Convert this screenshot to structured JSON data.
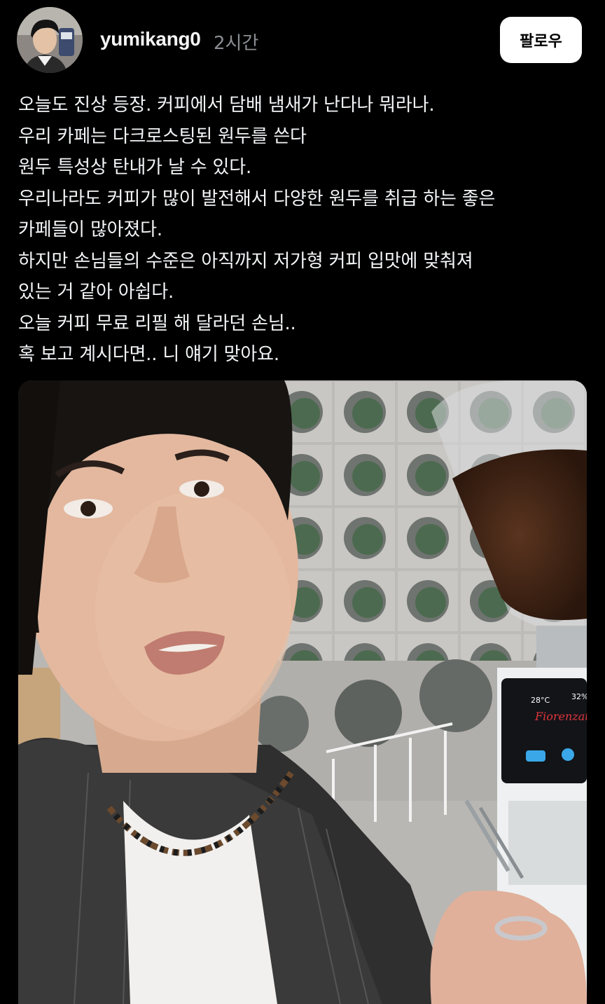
{
  "post": {
    "author": {
      "username": "yumikang0"
    },
    "timestamp": "2시간",
    "follow_label": "팔로우",
    "text_lines": [
      "오늘도 진상 등장. 커피에서 담배 냄새가 난다나 뭐라나.",
      "우리 카페는 다크로스팅된 원두를 쓴다",
      "원두 특성상 탄내가 날 수 있다.",
      "우리나라도 커피가 많이 발전해서 다양한 원두를 취급 하는 좋은",
      "카페들이 많아졌다.",
      "하지만 손님들의 수준은 아직까지 저가형 커피 입맛에 맞춰져",
      "있는 거 같아 아쉽다.",
      "오늘 커피 무료 리필 해 달라던 손님..",
      "혹 보고 계시다면.. 니 얘기 맞아요."
    ],
    "media": {
      "kind": "photo",
      "display_brand": "Fiorenzato",
      "display_temp": "28°C",
      "display_pct": "32%"
    }
  },
  "colors": {
    "background": "#000000",
    "text_primary": "#f3f5f7",
    "text_secondary": "#8a8d91",
    "follow_button_bg": "#ffffff",
    "follow_button_text": "#000000"
  }
}
